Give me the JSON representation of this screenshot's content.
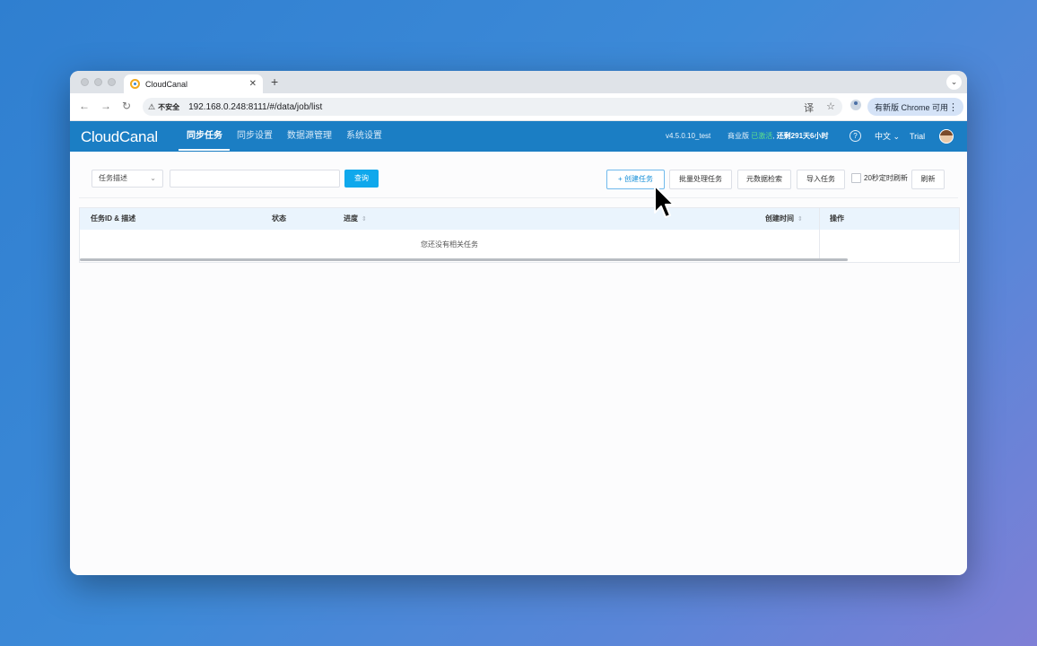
{
  "browser": {
    "tab_title": "CloudCanal",
    "tab_close": "✕",
    "new_tab": "+",
    "tab_menu": "⌄",
    "back": "←",
    "forward": "→",
    "reload": "↻",
    "security_icon": "⚠",
    "security_label": "不安全",
    "url": "192.168.0.248:8111/#/data/job/list",
    "translate_icon": "译",
    "star_icon": "☆",
    "update_label": "有新版 Chrome 可用",
    "more_icon": "⋮"
  },
  "app": {
    "logo": "CloudCanal",
    "nav": [
      "同步任务",
      "同步设置",
      "数据源管理",
      "系统设置"
    ],
    "active_nav_index": 0,
    "version": "v4.5.0.10_test",
    "edition_prefix": "商业版",
    "edition_status": "已激活",
    "edition_remaining": "还剩291天6小时",
    "help_icon": "?",
    "language": "中文 ⌄",
    "user": "Trial"
  },
  "filters": {
    "select_value": "任务描述",
    "select_chevron": "⌄",
    "search_placeholder": "",
    "query_button": "查询",
    "create_button": "+ 创建任务",
    "batch_button": "批量处理任务",
    "metadata_button": "元数据检索",
    "import_button": "导入任务",
    "auto_refresh_label": "20秒定时刷新",
    "refresh_button": "刷新"
  },
  "table": {
    "columns": [
      "任务ID & 描述",
      "状态",
      "进度",
      "创建时间",
      "操作"
    ],
    "sort_glyph": "⇕",
    "empty_text": "您还没有相关任务"
  },
  "colors": {
    "app_header": "#1b7ec4",
    "primary_button": "#0fa8ec",
    "table_header": "#eaf4fd"
  }
}
